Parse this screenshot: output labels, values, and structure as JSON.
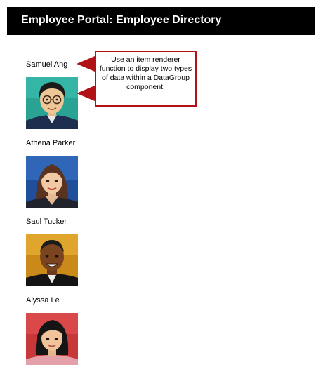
{
  "header": {
    "title": "Employee Portal: Employee Directory"
  },
  "employees": [
    {
      "name": "Samuel Ang",
      "photo_icon": "employee-photo-samuel-ang"
    },
    {
      "name": "Athena Parker",
      "photo_icon": "employee-photo-athena-parker"
    },
    {
      "name": "Saul Tucker",
      "photo_icon": "employee-photo-saul-tucker"
    },
    {
      "name": "Alyssa Le",
      "photo_icon": "employee-photo-alyssa-le"
    }
  ],
  "callout": {
    "text": "Use an item renderer function to display two types of data within a DataGroup component.",
    "border_color": "#b01218"
  },
  "colors": {
    "header_bg": "#000000",
    "header_text": "#ffffff",
    "accent": "#b01218"
  }
}
